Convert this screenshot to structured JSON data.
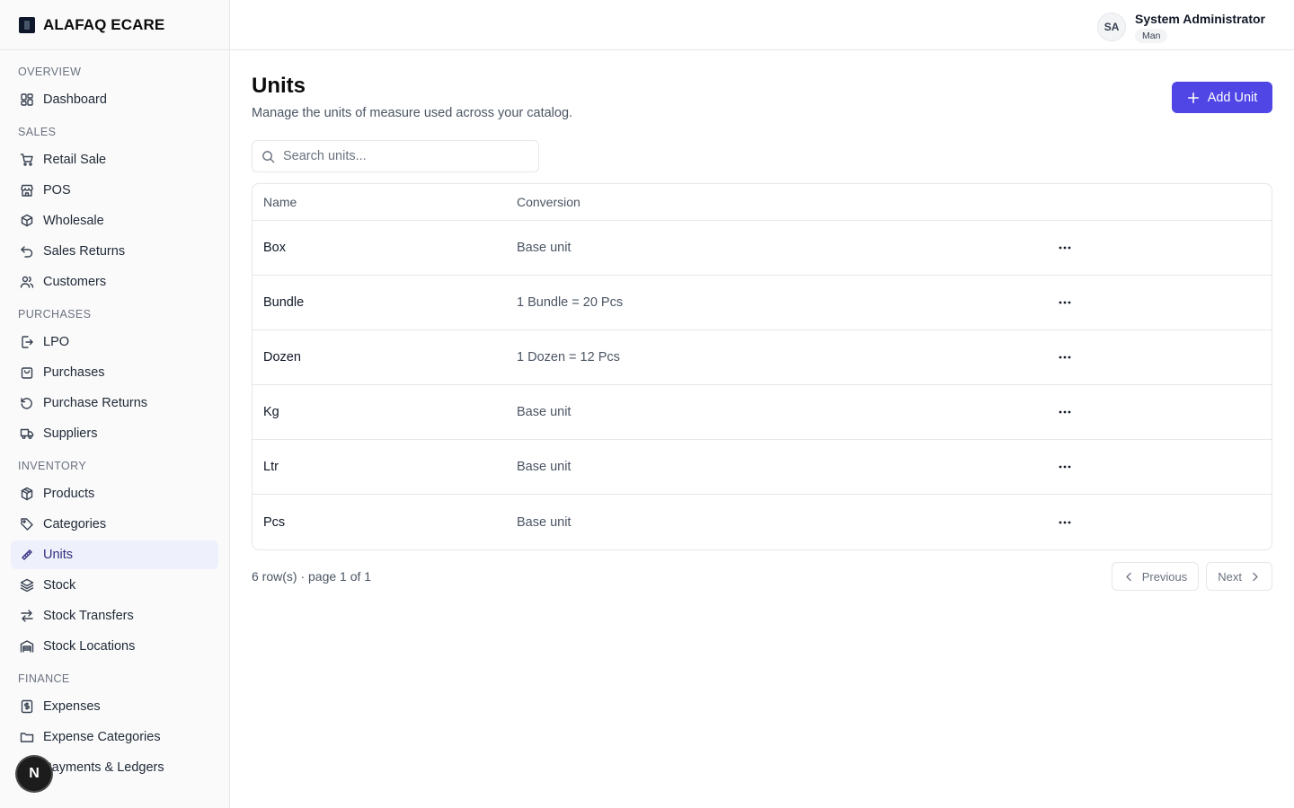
{
  "brand": {
    "name": "ALAFAQ ECARE"
  },
  "sidebar": {
    "sections": [
      {
        "title": "OVERVIEW",
        "items": [
          {
            "label": "Dashboard",
            "icon": "dashboard-icon"
          }
        ]
      },
      {
        "title": "SALES",
        "items": [
          {
            "label": "Retail Sale",
            "icon": "cart-icon"
          },
          {
            "label": "POS",
            "icon": "store-icon"
          },
          {
            "label": "Wholesale",
            "icon": "boxes-icon"
          },
          {
            "label": "Sales Returns",
            "icon": "undo-icon"
          },
          {
            "label": "Customers",
            "icon": "users-icon"
          }
        ]
      },
      {
        "title": "PURCHASES",
        "items": [
          {
            "label": "LPO",
            "icon": "file-export-icon"
          },
          {
            "label": "Purchases",
            "icon": "bag-icon"
          },
          {
            "label": "Purchase Returns",
            "icon": "rotate-ccw-icon"
          },
          {
            "label": "Suppliers",
            "icon": "truck-icon"
          }
        ]
      },
      {
        "title": "INVENTORY",
        "items": [
          {
            "label": "Products",
            "icon": "package-icon"
          },
          {
            "label": "Categories",
            "icon": "tag-icon"
          },
          {
            "label": "Units",
            "icon": "ruler-icon",
            "active": true
          },
          {
            "label": "Stock",
            "icon": "layers-icon"
          },
          {
            "label": "Stock Transfers",
            "icon": "arrows-left-right-icon"
          },
          {
            "label": "Stock Locations",
            "icon": "warehouse-icon"
          }
        ]
      },
      {
        "title": "FINANCE",
        "items": [
          {
            "label": "Expenses",
            "icon": "receipt-icon"
          },
          {
            "label": "Expense Categories",
            "icon": "folder-icon"
          },
          {
            "label": "Payments & Ledgers",
            "icon": "wallet-icon"
          }
        ]
      }
    ]
  },
  "header": {
    "user": {
      "initials": "SA",
      "name": "System Administrator",
      "role": "Man"
    }
  },
  "main": {
    "title": "Units",
    "description": "Manage the units of measure used across your catalog.",
    "add_button": "Add Unit",
    "search": {
      "placeholder": "Search units...",
      "value": ""
    },
    "table": {
      "columns": [
        "Name",
        "Conversion"
      ],
      "rows": [
        {
          "name": "Box",
          "conversion": "Base unit"
        },
        {
          "name": "Bundle",
          "conversion": "1 Bundle = 20 Pcs"
        },
        {
          "name": "Dozen",
          "conversion": "1 Dozen = 12 Pcs"
        },
        {
          "name": "Kg",
          "conversion": "Base unit"
        },
        {
          "name": "Ltr",
          "conversion": "Base unit"
        },
        {
          "name": "Pcs",
          "conversion": "Base unit"
        }
      ]
    },
    "footer": {
      "row_count": "6 row(s) · page 1 of 1",
      "previous": "Previous",
      "next": "Next"
    }
  },
  "floating_button": {
    "label": "N"
  },
  "colors": {
    "accent": "#4f46e5",
    "active_bg": "#eef0fb",
    "active_text": "#312e81"
  }
}
